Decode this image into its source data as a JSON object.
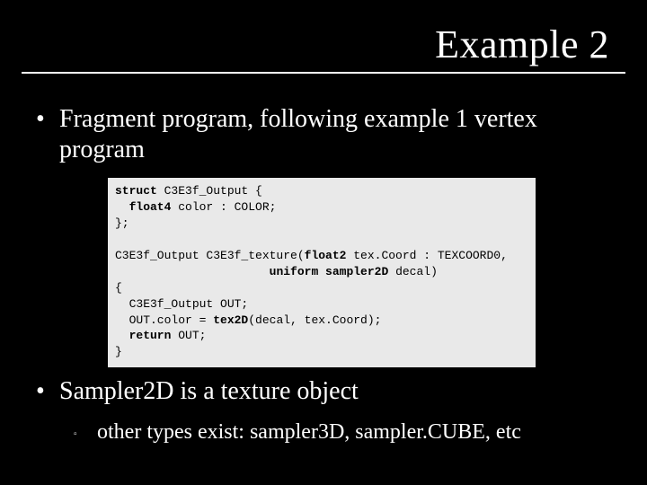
{
  "title": "Example 2",
  "bullets": {
    "b1": "Fragment program, following example 1 vertex program",
    "b2": "Sampler2D is a texture object",
    "sub1": "other types exist: sampler3D, sampler.CUBE, etc"
  },
  "code": {
    "l1a": "struct",
    "l1b": " C3E3f_Output {",
    "l2a": "  float4",
    "l2b": " color : COLOR;",
    "l3": "};",
    "l4": "",
    "l5a": "C3E3f_Output C3E3f_texture(",
    "l5b": "float2",
    "l5c": " tex.Coord : TEXCOORD0,",
    "l6a": "                      ",
    "l6b": "uniform sampler2D",
    "l6c": " decal)",
    "l7": "{",
    "l8": "  C3E3f_Output OUT;",
    "l9a": "  OUT.color = ",
    "l9b": "tex2D",
    "l9c": "(decal, tex.Coord);",
    "l10a": "  return",
    "l10b": " OUT;",
    "l11": "}"
  }
}
